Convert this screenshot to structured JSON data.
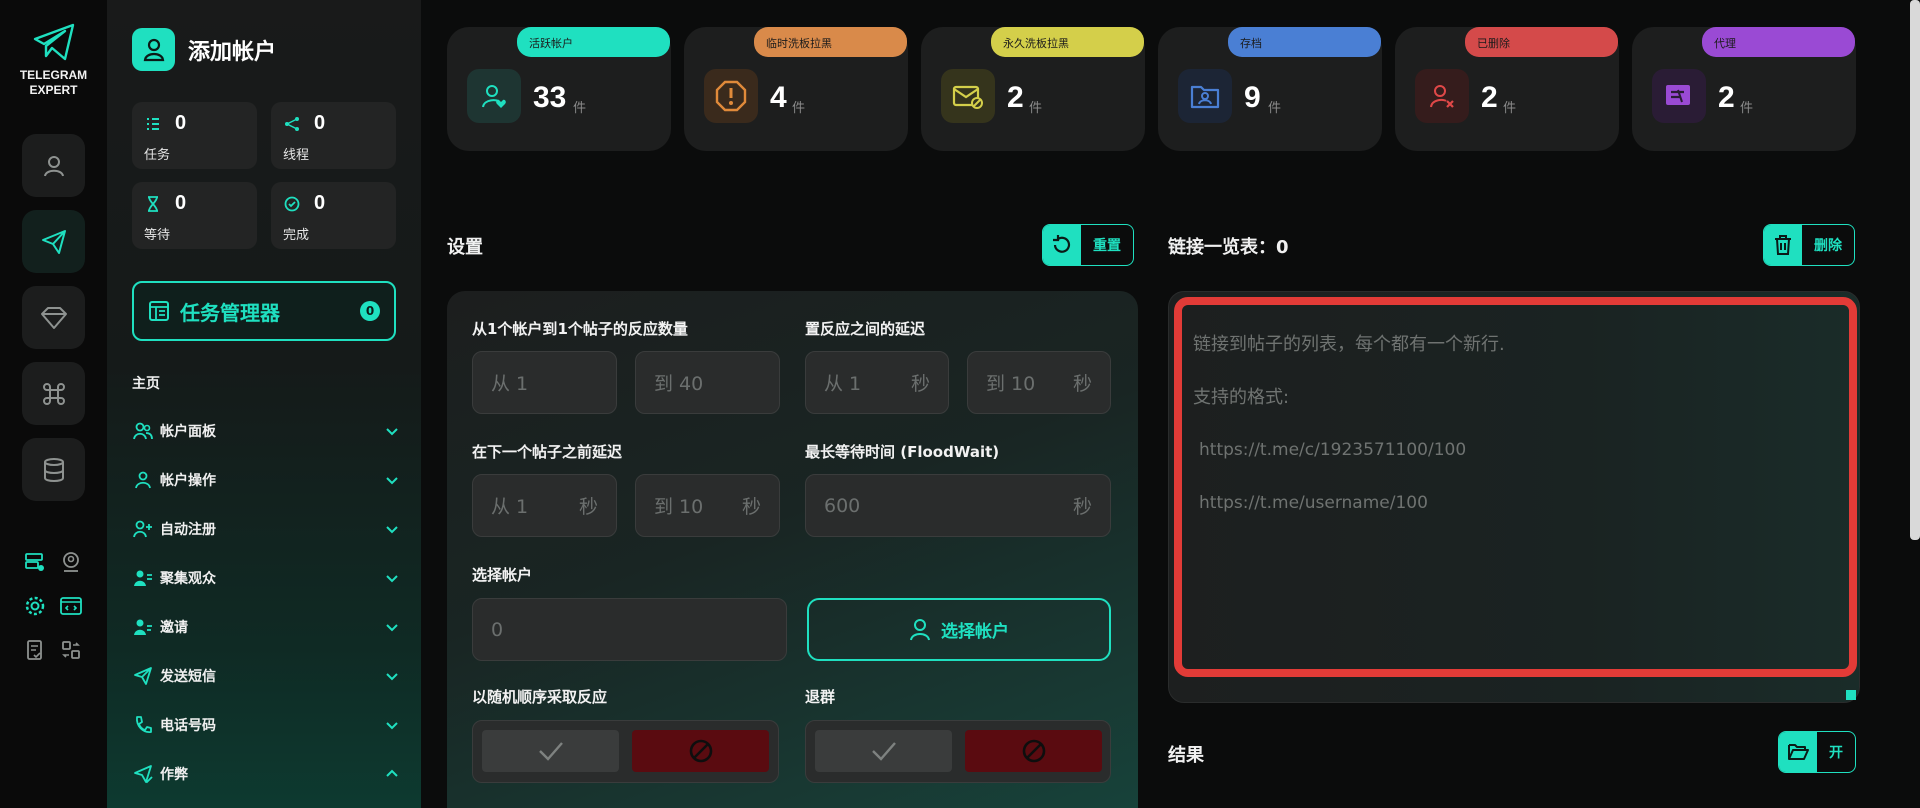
{
  "brand": {
    "logo_line1": "TELEGRAM",
    "logo_line2": "EXPERT",
    "title": "添加帐户"
  },
  "side_stats": [
    {
      "icon": "list-icon",
      "value": "0",
      "label": "任务"
    },
    {
      "icon": "share-icon",
      "value": "0",
      "label": "线程"
    },
    {
      "icon": "hourglass-icon",
      "value": "0",
      "label": "等待"
    },
    {
      "icon": "check-circle-icon",
      "value": "0",
      "label": "完成"
    }
  ],
  "task_manager": {
    "label": "任务管理器",
    "count": "0"
  },
  "nav": {
    "heading": "主页",
    "items": [
      {
        "label": "帐户面板",
        "icon": "users-icon"
      },
      {
        "label": "帐户操作",
        "icon": "user-icon"
      },
      {
        "label": "自动注册",
        "icon": "user-plus-icon"
      },
      {
        "label": "聚集观众",
        "icon": "user-group-icon"
      },
      {
        "label": "邀请",
        "icon": "user-add-icon"
      },
      {
        "label": "发送短信",
        "icon": "send-icon"
      },
      {
        "label": "电话号码",
        "icon": "phone-icon"
      },
      {
        "label": "作弊",
        "icon": "send-check-icon"
      }
    ]
  },
  "cards": [
    {
      "tag": "活跃帐户",
      "value": "33",
      "unit": "件",
      "color": "#1fe0c0"
    },
    {
      "tag": "临时洗板拉黑",
      "value": "4",
      "unit": "件",
      "color": "#d98a4a"
    },
    {
      "tag": "永久洗板拉黑",
      "value": "2",
      "unit": "件",
      "color": "#d4cf4a"
    },
    {
      "tag": "存档",
      "value": "9",
      "unit": "件",
      "color": "#4a7fd4"
    },
    {
      "tag": "已删除",
      "value": "2",
      "unit": "件",
      "color": "#d44a4a"
    },
    {
      "tag": "代理",
      "value": "2",
      "unit": "件",
      "color": "#9a4ad4"
    }
  ],
  "settings": {
    "title": "设置",
    "reset_label": "重置",
    "reactions_label": "从1个帐户到1个帖子的反应数量",
    "reactions_from": "从  1",
    "reactions_to": "到  40",
    "delay_label": "置反应之间的延迟",
    "delay_from": "从  1",
    "delay_to": "到  10",
    "sec": "秒",
    "next_delay_label": "在下一个帖子之前延迟",
    "next_from": "从  1",
    "next_to": "到  10",
    "floodwait_label": "最长等待时间 (FloodWait)",
    "floodwait_value": "600",
    "select_label": "选择帐户",
    "select_value": "0",
    "select_button": "选择帐户",
    "random_label": "以随机顺序采取反应",
    "leave_label": "退群"
  },
  "links": {
    "title": "链接一览表：0",
    "delete_label": "删除",
    "placeholder_line1": "链接到帖子的列表，每个都有一个新行.",
    "placeholder_line2": "支持的格式:",
    "example1": "https://t.me/c/1923571100/100",
    "example2": "https://t.me/username/100"
  },
  "results": {
    "title": "结果",
    "open_label": "开"
  }
}
